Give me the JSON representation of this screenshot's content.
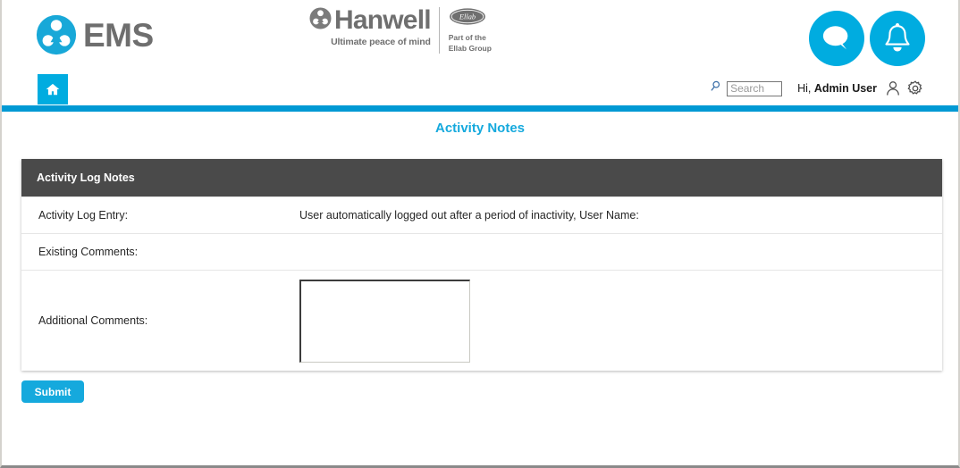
{
  "header": {
    "ems_logo_text": "EMS",
    "ems_logo_icon": "ems-trefoil-logo-icon",
    "hanwell": {
      "name": "Hanwell",
      "tagline": "Ultimate peace of mind",
      "mark_icon": "hanwell-trefoil-icon",
      "ellab_badge_icon": "ellab-oval-logo-icon",
      "ellab_line1": "Part of the",
      "ellab_line2": "Ellab Group"
    },
    "chat_icon": "chat-bubble-icon",
    "bell_icon": "bell-notification-icon"
  },
  "nav": {
    "home_icon": "home-icon",
    "search": {
      "icon": "search-magnifier-icon",
      "value": "",
      "placeholder": "Search"
    },
    "greeting_prefix": "Hi,",
    "user_name": "Admin User",
    "user_icon": "user-person-icon",
    "settings_icon": "gear-settings-icon"
  },
  "page": {
    "title": "Activity Notes"
  },
  "panel": {
    "header_title": "Activity Log Notes",
    "rows": [
      {
        "label": "Activity Log Entry:",
        "value": "User automatically logged out after a period of inactivity, User Name:"
      },
      {
        "label": "Existing Comments:",
        "value": ""
      },
      {
        "label": "Additional Comments:",
        "value": ""
      }
    ]
  },
  "actions": {
    "submit_label": "Submit"
  },
  "colors": {
    "accent_cyan": "#00ace0",
    "title_cyan": "#15a9dd",
    "divider_blue": "#0099d4",
    "panel_header_gray": "#4a4a4a",
    "logo_gray": "#6e6e6e"
  }
}
